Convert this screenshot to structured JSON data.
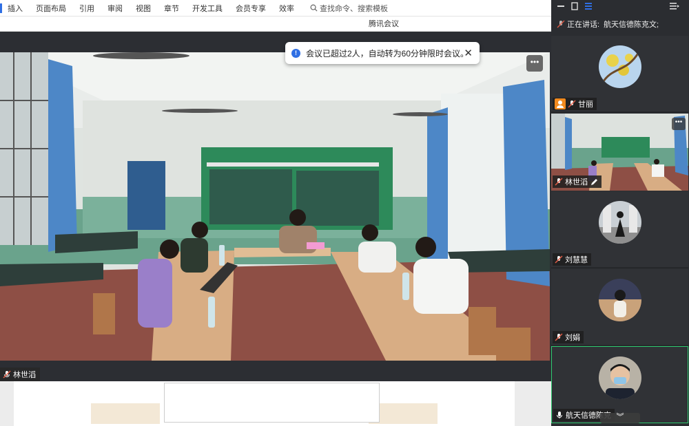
{
  "ribbon": {
    "tabs": [
      "插入",
      "页面布局",
      "引用",
      "审阅",
      "视图",
      "章节",
      "开发工具",
      "会员专享",
      "效率"
    ],
    "search_placeholder": "查找命令、搜索模板"
  },
  "app": {
    "title": "腾讯会议"
  },
  "toast": {
    "message": "会议已超过2人，自动转为60分钟限时会议。",
    "close_glyph": "✕",
    "info_glyph": "!"
  },
  "main_video": {
    "participant": "林世滔",
    "more_glyph": "•••"
  },
  "sidebar": {
    "speaking_label": "正在讲话:",
    "speaking_name": "航天信德陈克文;",
    "participants": [
      {
        "name": "甘丽",
        "type": "avatar"
      },
      {
        "name": "林世滔",
        "type": "video",
        "editing": true
      },
      {
        "name": "刘慧慧",
        "type": "avatar"
      },
      {
        "name": "刘娟",
        "type": "avatar"
      },
      {
        "name": "航天信德陈克",
        "type": "avatar",
        "active": true
      }
    ],
    "more_glyph": "•••",
    "collapse_glyph": "︾"
  },
  "colors": {
    "accent": "#2f6fe4",
    "active_border": "#2ecc71",
    "mic_muted": "#e25b45",
    "orange_badge": "#f28a1e"
  }
}
